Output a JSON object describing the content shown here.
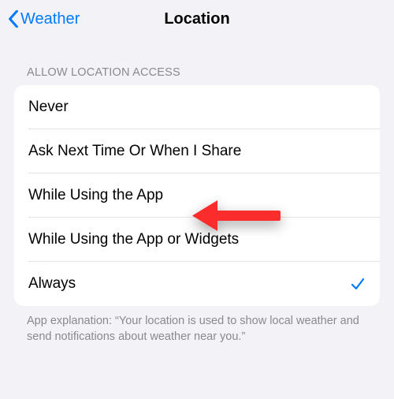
{
  "nav": {
    "back_label": "Weather",
    "title": "Location"
  },
  "section": {
    "header": "ALLOW LOCATION ACCESS",
    "footer": "App explanation: “Your location is used to show local weather and send notifications about weather near you.”"
  },
  "options": [
    {
      "label": "Never",
      "selected": false
    },
    {
      "label": "Ask Next Time Or When I Share",
      "selected": false
    },
    {
      "label": "While Using the App",
      "selected": false
    },
    {
      "label": "While Using the App or Widgets",
      "selected": false
    },
    {
      "label": "Always",
      "selected": true
    }
  ],
  "annotation": {
    "type": "arrow",
    "color": "#fb2c2c",
    "points_to_option_index": 2
  }
}
